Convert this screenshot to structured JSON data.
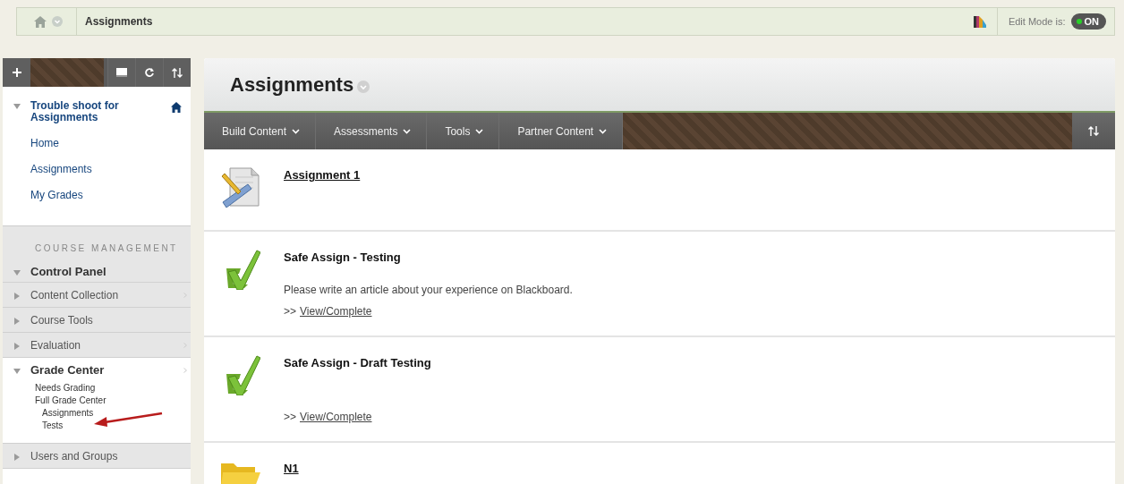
{
  "breadcrumb": {
    "title": "Assignments"
  },
  "edit_mode": {
    "label": "Edit Mode is:",
    "state": "ON",
    "on": true
  },
  "sidebar": {
    "course": {
      "title": "Trouble shoot for Assignments",
      "expanded": true,
      "links": [
        {
          "label": "Home"
        },
        {
          "label": "Assignments"
        },
        {
          "label": "My Grades"
        }
      ]
    },
    "management": {
      "heading": "COURSE MANAGEMENT",
      "panel": {
        "title": "Control Panel",
        "expanded": true
      },
      "sections": [
        {
          "label": "Content Collection",
          "expanded": false
        },
        {
          "label": "Course Tools",
          "expanded": false
        },
        {
          "label": "Evaluation",
          "expanded": false
        },
        {
          "label": "Grade Center",
          "expanded": true,
          "children": [
            {
              "label": "Needs Grading"
            },
            {
              "label": "Full Grade Center",
              "children": [
                {
                  "label": "Assignments"
                },
                {
                  "label": "Tests"
                }
              ]
            }
          ]
        },
        {
          "label": "Users and Groups",
          "expanded": false
        }
      ]
    }
  },
  "content": {
    "title": "Assignments",
    "menu": [
      {
        "label": "Build Content"
      },
      {
        "label": "Assessments"
      },
      {
        "label": "Tools"
      },
      {
        "label": "Partner Content"
      }
    ],
    "items": [
      {
        "kind": "assignment",
        "title": "Assignment 1"
      },
      {
        "kind": "test",
        "title": "Safe Assign - Testing",
        "description": "Please write an article about your experience on Blackboard.",
        "action_prefix": ">>",
        "action": "View/Complete"
      },
      {
        "kind": "test",
        "title": "Safe Assign - Draft Testing",
        "action_prefix": ">>",
        "action": "View/Complete"
      },
      {
        "kind": "folder",
        "title": "N1"
      }
    ]
  }
}
